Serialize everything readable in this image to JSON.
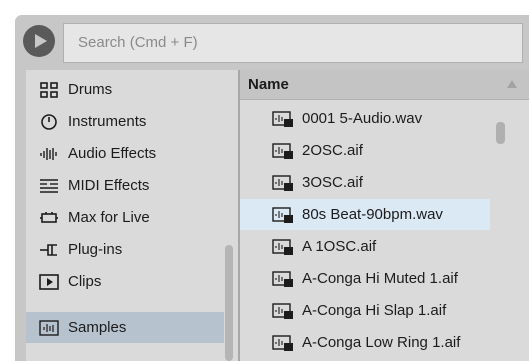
{
  "search": {
    "placeholder": "Search (Cmd + F)"
  },
  "sidebar": {
    "items": [
      {
        "label": "Drums",
        "icon": "drum-grid-icon"
      },
      {
        "label": "Instruments",
        "icon": "instrument-clock-icon"
      },
      {
        "label": "Audio Effects",
        "icon": "audio-effects-icon"
      },
      {
        "label": "MIDI Effects",
        "icon": "midi-effects-icon"
      },
      {
        "label": "Max for Live",
        "icon": "max-for-live-icon"
      },
      {
        "label": "Plug-ins",
        "icon": "plugin-icon"
      },
      {
        "label": "Clips",
        "icon": "clip-icon"
      },
      {
        "label": "Samples",
        "icon": "sample-icon",
        "selected": true
      }
    ]
  },
  "filelist": {
    "header": "Name",
    "items": [
      {
        "label": "0001 5-Audio.wav"
      },
      {
        "label": "2OSC.aif"
      },
      {
        "label": "3OSC.aif"
      },
      {
        "label": "80s Beat-90bpm.wav",
        "selected": true
      },
      {
        "label": "A 1OSC.aif"
      },
      {
        "label": "A-Conga Hi Muted 1.aif"
      },
      {
        "label": "A-Conga Hi Slap 1.aif"
      },
      {
        "label": "A-Conga Low Ring 1.aif"
      }
    ]
  },
  "colors": {
    "selected_sidebar": "#b6c3cf",
    "selected_row": "#dbe9f5",
    "panel": "#dadada"
  }
}
